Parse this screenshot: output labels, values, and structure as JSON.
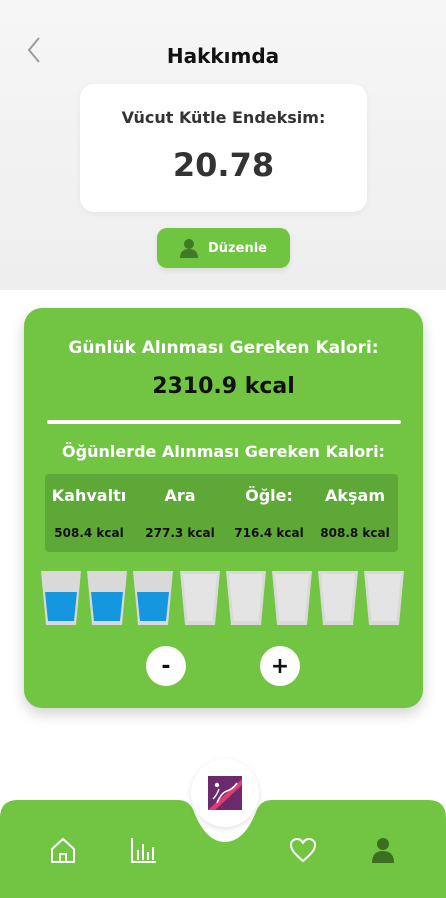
{
  "header": {
    "title": "Hakkımda",
    "back_icon": "chevron-left-icon"
  },
  "bmi": {
    "label": "Vücut Kütle Endeksim:",
    "value": "20.78"
  },
  "edit_button": {
    "label": "Düzenle",
    "icon": "user-icon"
  },
  "calories": {
    "daily_label": "Günlük Alınması Gereken Kalori:",
    "daily_value": "2310.9 kcal",
    "meals_label": "Öğünlerde Alınması Gereken Kalori:",
    "meals": [
      {
        "name": "Kahvaltı",
        "kcal": "508.4 kcal"
      },
      {
        "name": "Ara",
        "kcal": "277.3 kcal"
      },
      {
        "name": "Öğle:",
        "kcal": "716.4 kcal"
      },
      {
        "name": "Akşam",
        "kcal": "808.8 kcal"
      }
    ]
  },
  "water": {
    "filled": 3,
    "total": 8,
    "minus_label": "-",
    "plus_label": "+"
  },
  "nav": {
    "items": [
      "home-icon",
      "stats-icon",
      "heart-icon",
      "profile-icon"
    ],
    "center": "app-logo-icon"
  },
  "colors": {
    "green": "#72c543",
    "green_dark": "#5ea838",
    "water": "#1597e0",
    "cup": "#d9d9d9"
  }
}
